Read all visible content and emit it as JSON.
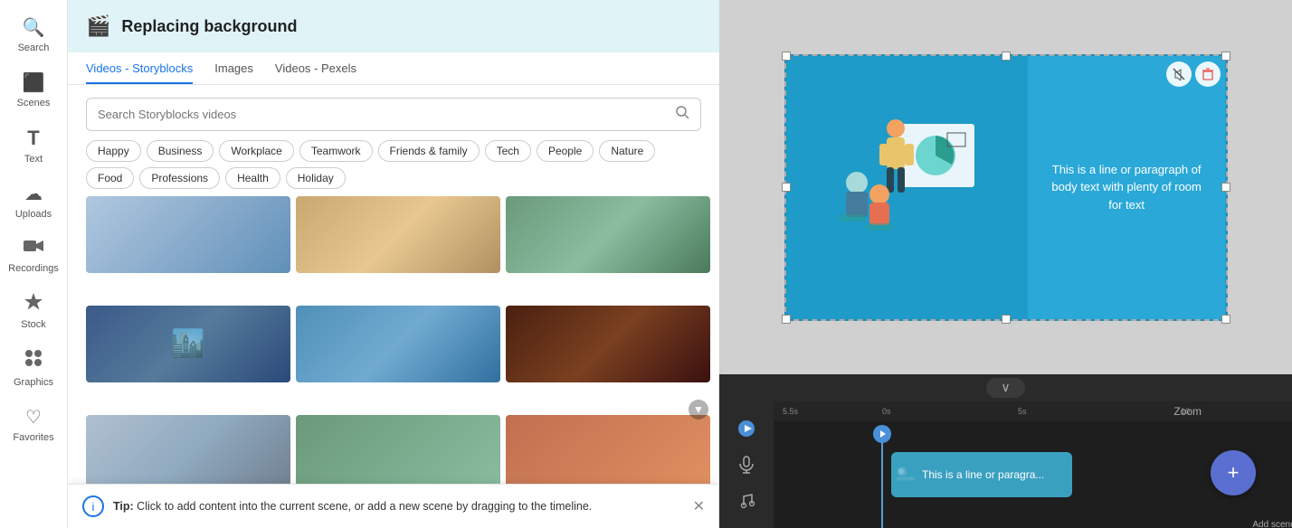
{
  "sidebar": {
    "items": [
      {
        "id": "search",
        "label": "Search",
        "icon": "🔍"
      },
      {
        "id": "scenes",
        "label": "Scenes",
        "icon": "🎬"
      },
      {
        "id": "text",
        "label": "Text",
        "icon": "T"
      },
      {
        "id": "uploads",
        "label": "Uploads",
        "icon": "☁"
      },
      {
        "id": "recordings",
        "label": "Recordings",
        "icon": "📹"
      },
      {
        "id": "stock",
        "label": "Stock",
        "icon": "⭐"
      },
      {
        "id": "graphics",
        "label": "Graphics",
        "icon": "✦"
      },
      {
        "id": "favorites",
        "label": "Favorites",
        "icon": "♡"
      }
    ]
  },
  "panel": {
    "title": "Replacing background",
    "tabs": [
      {
        "id": "storyblocks",
        "label": "Videos - Storyblocks",
        "active": true
      },
      {
        "id": "images",
        "label": "Images",
        "active": false
      },
      {
        "id": "pexels",
        "label": "Videos - Pexels",
        "active": false
      }
    ],
    "search": {
      "placeholder": "Search Storyblocks videos"
    },
    "tags": [
      "Happy",
      "Business",
      "Workplace",
      "Teamwork",
      "Friends & family",
      "Tech",
      "People",
      "Nature",
      "Food",
      "Professions",
      "Health",
      "Holiday"
    ]
  },
  "tooltip": {
    "text_prefix": "Tip:",
    "text_body": " Click to add content into the current scene, or add a new scene by dragging to the timeline."
  },
  "scene": {
    "body_text": "This is a line or paragraph of body text with plenty of room for text"
  },
  "timeline": {
    "clip_text": "This is a line or paragra...",
    "add_scene_label": "Add scene",
    "zoom_label": "Zoom",
    "time_left": "5.5s",
    "time_markers": [
      "0s",
      "5s",
      "10"
    ],
    "collapse_icon": "∨",
    "play_icon": "▶",
    "mic_icon": "🎤",
    "music_icon": "🎵"
  }
}
